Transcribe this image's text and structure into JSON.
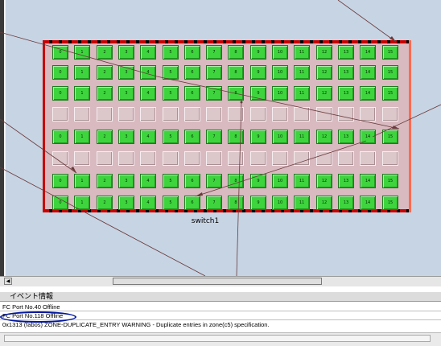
{
  "fabric": {
    "switch_label": "switch1",
    "colors": {
      "port_online": "#3ed43e",
      "port_offline": "#dcc7cb",
      "switch_border": "#c80000",
      "link_line": "#6a3b3b",
      "canvas_bg": "#c7d4e4"
    },
    "port_rows": [
      {
        "state": "online",
        "ports": [
          "0",
          "1",
          "2",
          "3",
          "4",
          "5",
          "6",
          "7",
          "8",
          "9",
          "10",
          "11",
          "12",
          "13",
          "14",
          "15"
        ]
      },
      {
        "state": "online",
        "ports": [
          "0",
          "1",
          "2",
          "3",
          "4",
          "5",
          "6",
          "7",
          "8",
          "9",
          "10",
          "11",
          "12",
          "13",
          "14",
          "15"
        ]
      },
      {
        "state": "online",
        "ports": [
          "0",
          "1",
          "2",
          "3",
          "4",
          "5",
          "6",
          "7",
          "8",
          "9",
          "10",
          "11",
          "12",
          "13",
          "14",
          "15"
        ]
      },
      {
        "state": "offline",
        "ports": [
          "",
          "",
          "",
          "",
          "",
          "",
          "",
          "",
          "",
          "",
          "",
          "",
          "",
          "",
          "",
          ""
        ]
      },
      {
        "state": "online",
        "ports": [
          "0",
          "1",
          "2",
          "3",
          "4",
          "5",
          "6",
          "7",
          "8",
          "9",
          "10",
          "11",
          "12",
          "13",
          "14",
          "15"
        ]
      },
      {
        "state": "offline",
        "ports": [
          "",
          "",
          "",
          "",
          "",
          "",
          "",
          "",
          "",
          "",
          "",
          "",
          "",
          "",
          "",
          ""
        ]
      },
      {
        "state": "online",
        "ports": [
          "0",
          "1",
          "2",
          "3",
          "4",
          "5",
          "6",
          "7",
          "8",
          "9",
          "10",
          "11",
          "12",
          "13",
          "14",
          "15"
        ]
      },
      {
        "state": "online",
        "ports": [
          "0",
          "1",
          "2",
          "3",
          "4",
          "5",
          "6",
          "7",
          "8",
          "9",
          "10",
          "11",
          "12",
          "13",
          "14",
          "15"
        ]
      }
    ]
  },
  "events": {
    "header": "イベント情報",
    "rows": [
      "FC Port No.40 Offline",
      "FC Port No.118 Offline",
      "0x1313 (fabos) ZONE-DUPLICATE_ENTRY WARNING - Duplicate entries in zone(c5) specification."
    ]
  },
  "scrollbar": {
    "left_arrow": "◀"
  }
}
